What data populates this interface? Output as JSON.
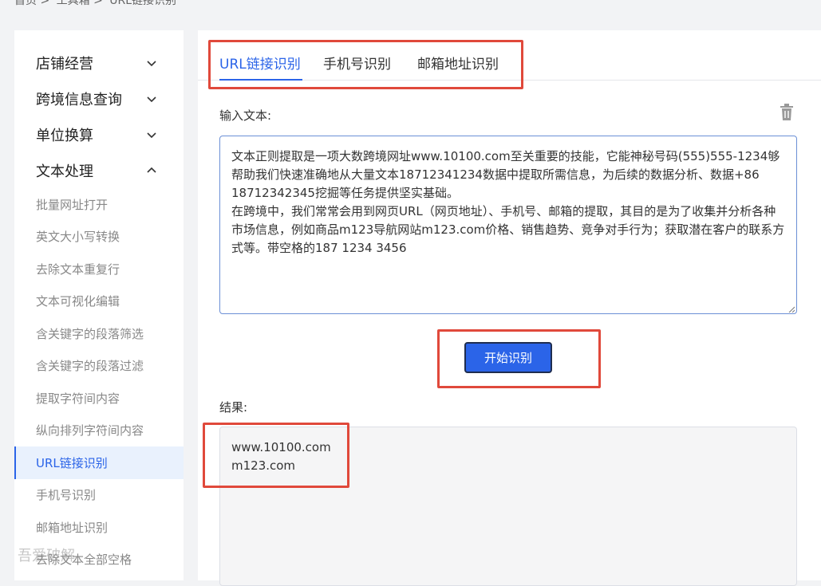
{
  "breadcrumb": [
    "首页 >",
    "工具箱 >",
    "URL链接识别"
  ],
  "sidebar": {
    "groups": [
      {
        "label": "店铺经营",
        "expanded": false
      },
      {
        "label": "跨境信息查询",
        "expanded": false
      },
      {
        "label": "单位换算",
        "expanded": false
      },
      {
        "label": "文本处理",
        "expanded": true
      }
    ],
    "items": [
      "批量网址打开",
      "英文大小写转换",
      "去除文本重复行",
      "文本可视化编辑",
      "含关键字的段落筛选",
      "含关键字的段落过滤",
      "提取字符间内容",
      "纵向排列字符间内容",
      "URL链接识别",
      "手机号识别",
      "邮箱地址识别",
      "去除文本全部空格"
    ],
    "active_item": "URL链接识别"
  },
  "tabs": [
    "URL链接识别",
    "手机号识别",
    "邮箱地址识别"
  ],
  "input": {
    "label": "输入文本:",
    "value": "文本正则提取是一项大数跨境网址www.10100.com至关重要的技能，它能神秘号码(555)555-1234够帮助我们快速准确地从大量文本18712341234数据中提取所需信息，为后续的数据分析、数据+86 18712342345挖掘等任务提供坚实基础。\n在跨境中，我们常常会用到网页URL（网页地址）、手机号、邮箱的提取，其目的是为了收集并分析各种市场信息，例如商品m123导航网站m123.com价格、销售趋势、竞争对手行为；获取潜在客户的联系方式等。带空格的187 1234 3456"
  },
  "start_button": "开始识别",
  "result": {
    "label": "结果:",
    "lines": [
      "www.10100.com",
      "m123.com"
    ]
  },
  "watermark": "吾爱破解",
  "colors": {
    "accent": "#2b64e8",
    "highlight": "#e0493b"
  }
}
